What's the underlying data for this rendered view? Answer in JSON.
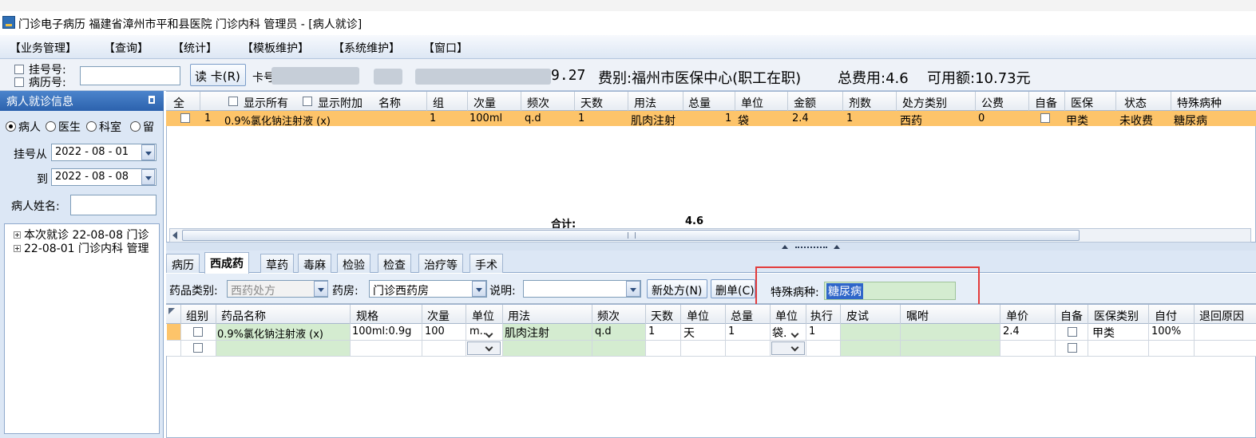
{
  "window": {
    "title": "门诊电子病历  福建省漳州市平和县医院  门诊内科  管理员 - [病人就诊]"
  },
  "menu": [
    "【业务管理】",
    "【查询】",
    "【统计】",
    "【模板维护】",
    "【系统维护】",
    "【窗口】"
  ],
  "infobar": {
    "reg_no_label": "挂号号:",
    "record_no_label": "病历号:",
    "read_card": "读 卡(R)",
    "card_no_label": "卡号",
    "amount_tail": "9.27",
    "fee_type": "费别:福州市医保中心(职工在职)",
    "total_fee": "总费用:4.6",
    "available": "可用额:10.73元"
  },
  "left_panel": {
    "header": "病人就诊信息",
    "pin": "ᴾ",
    "radios": [
      "病人",
      "医生",
      "科室",
      "留"
    ],
    "reg_from_label": "挂号从",
    "reg_from": "2022 - 08 - 01",
    "to_label": "到",
    "reg_to": "2022 - 08 - 08",
    "patient_name_label": "病人姓名:",
    "tree": [
      "本次就诊  22-08-08  门诊",
      "22-08-01  门诊内科  管理"
    ]
  },
  "upper_grid": {
    "all_label": "全",
    "show_all": "显示所有",
    "show_extra": "显示附加",
    "columns": [
      "名称",
      "组",
      "次量",
      "频次",
      "天数",
      "用法",
      "总量",
      "单位",
      "金额",
      "剂数",
      "处方类别",
      "公费",
      "自备",
      "医保",
      "状态",
      "特殊病种"
    ],
    "row": {
      "index": "1",
      "name": "0.9%氯化钠注射液 (x)",
      "group": "1",
      "dose": "100ml",
      "freq": "q.d",
      "days": "1",
      "usage": "肌肉注射",
      "total": "1",
      "unit": "袋",
      "amount": "2.4",
      "doses": "1",
      "rx_type": "西药",
      "public_fee": "0",
      "insurance": "甲类",
      "status": "未收费",
      "special": "糖尿病"
    },
    "sum_label": "合计:",
    "sum_value": "4.6"
  },
  "tabs": [
    "病历",
    "西成药",
    "草药",
    "毒麻",
    "检验",
    "检查",
    "治疗等",
    "手术"
  ],
  "toolbar": {
    "drug_cat_label": "药品类别:",
    "drug_cat": "西药处方",
    "pharmacy_label": "药房:",
    "pharmacy": "门诊西药房",
    "note_label": "说明:",
    "note": "",
    "new_rx": "新处方(N)",
    "delete_rx": "删单(C)",
    "special_label": "特殊病种:",
    "special_value": "糖尿病"
  },
  "lower_grid": {
    "columns": [
      "组别",
      "药品名称",
      "规格",
      "次量",
      "单位",
      "用法",
      "频次",
      "天数",
      "单位",
      "总量",
      "单位",
      "执行",
      "皮试",
      "嘱咐",
      "单价",
      "自备",
      "医保类别",
      "自付",
      "退回原因"
    ],
    "row": {
      "name": "0.9%氯化钠注射液 (x)",
      "spec": "100ml:0.9g",
      "dose": "100",
      "dose_unit": "m..",
      "usage": "肌肉注射",
      "freq": "q.d",
      "days": "1",
      "days_unit": "天",
      "total": "1",
      "total_unit": "袋.",
      "exec": "1",
      "price": "2.4",
      "insurance_cat": "甲类",
      "self_pay": "100%"
    }
  },
  "colors": {
    "selected_row": "#fdc46a",
    "editable_cell": "#d4ecd0",
    "highlight_box": "#e33b3b",
    "panel_header": "#2c62ad"
  }
}
